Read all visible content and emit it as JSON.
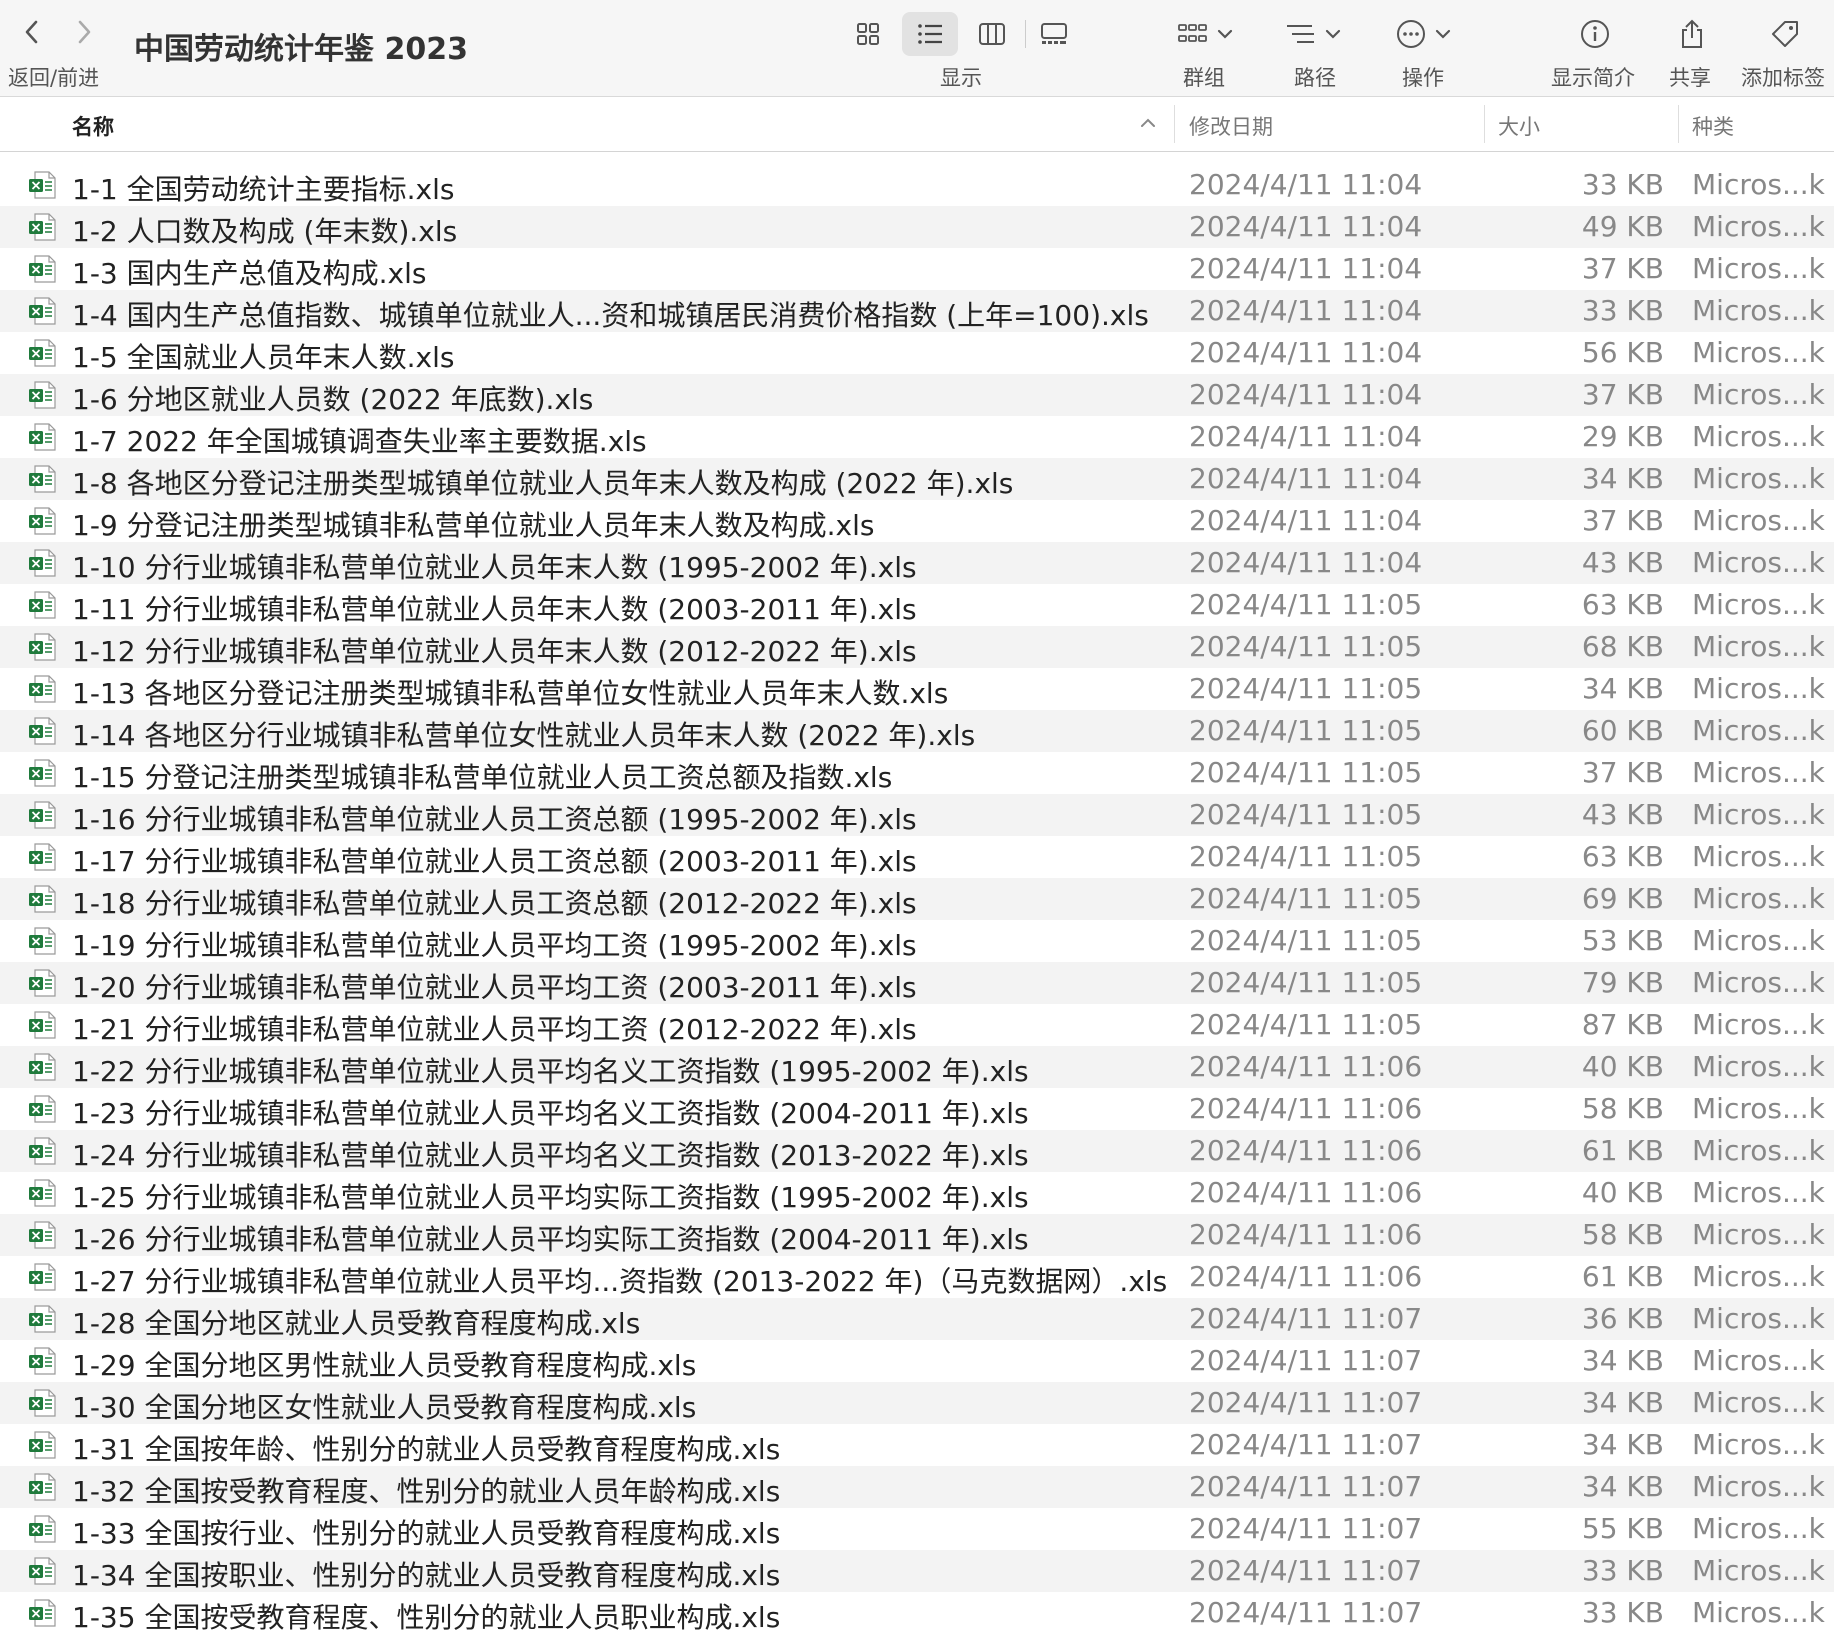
{
  "toolbar": {
    "nav_label": "返回/前进",
    "window_title": "中国劳动统计年鉴 2023",
    "view_label": "显示",
    "group_label": "群组",
    "path_label": "路径",
    "action_label": "操作",
    "info_label": "显示简介",
    "share_label": "共享",
    "tag_label": "添加标签",
    "active_view": "list"
  },
  "columns": {
    "name": "名称",
    "date": "修改日期",
    "size": "大小",
    "kind": "种类"
  },
  "icons": {
    "file": "excel-file-icon",
    "accent_color": "#1f7a3c"
  },
  "files": [
    {
      "name": "1-1 全国劳动统计主要指标.xls",
      "date": "2024/4/11 11:04",
      "size": "33 KB",
      "kind": "Micros...k ("
    },
    {
      "name": "1-2 人口数及构成 (年末数).xls",
      "date": "2024/4/11 11:04",
      "size": "49 KB",
      "kind": "Micros...k ("
    },
    {
      "name": "1-3 国内生产总值及构成.xls",
      "date": "2024/4/11 11:04",
      "size": "37 KB",
      "kind": "Micros...k ("
    },
    {
      "name": "1-4 国内生产总值指数、城镇单位就业人...资和城镇居民消费价格指数 (上年=100).xls",
      "date": "2024/4/11 11:04",
      "size": "33 KB",
      "kind": "Micros...k ("
    },
    {
      "name": "1-5 全国就业人员年末人数.xls",
      "date": "2024/4/11 11:04",
      "size": "56 KB",
      "kind": "Micros...k ("
    },
    {
      "name": "1-6 分地区就业人员数 (2022 年底数).xls",
      "date": "2024/4/11 11:04",
      "size": "37 KB",
      "kind": "Micros...k ("
    },
    {
      "name": "1-7 2022 年全国城镇调查失业率主要数据.xls",
      "date": "2024/4/11 11:04",
      "size": "29 KB",
      "kind": "Micros...k ("
    },
    {
      "name": "1-8 各地区分登记注册类型城镇单位就业人员年末人数及构成 (2022 年).xls",
      "date": "2024/4/11 11:04",
      "size": "34 KB",
      "kind": "Micros...k ("
    },
    {
      "name": "1-9 分登记注册类型城镇非私营单位就业人员年末人数及构成.xls",
      "date": "2024/4/11 11:04",
      "size": "37 KB",
      "kind": "Micros...k ("
    },
    {
      "name": "1-10 分行业城镇非私营单位就业人员年末人数 (1995-2002 年).xls",
      "date": "2024/4/11 11:04",
      "size": "43 KB",
      "kind": "Micros...k ("
    },
    {
      "name": "1-11 分行业城镇非私营单位就业人员年末人数 (2003-2011 年).xls",
      "date": "2024/4/11 11:05",
      "size": "63 KB",
      "kind": "Micros...k ("
    },
    {
      "name": "1-12 分行业城镇非私营单位就业人员年末人数 (2012-2022 年).xls",
      "date": "2024/4/11 11:05",
      "size": "68 KB",
      "kind": "Micros...k ("
    },
    {
      "name": "1-13 各地区分登记注册类型城镇非私营单位女性就业人员年末人数.xls",
      "date": "2024/4/11 11:05",
      "size": "34 KB",
      "kind": "Micros...k ("
    },
    {
      "name": "1-14 各地区分行业城镇非私营单位女性就业人员年末人数 (2022 年).xls",
      "date": "2024/4/11 11:05",
      "size": "60 KB",
      "kind": "Micros...k ("
    },
    {
      "name": "1-15 分登记注册类型城镇非私营单位就业人员工资总额及指数.xls",
      "date": "2024/4/11 11:05",
      "size": "37 KB",
      "kind": "Micros...k ("
    },
    {
      "name": "1-16 分行业城镇非私营单位就业人员工资总额 (1995-2002 年).xls",
      "date": "2024/4/11 11:05",
      "size": "43 KB",
      "kind": "Micros...k ("
    },
    {
      "name": "1-17 分行业城镇非私营单位就业人员工资总额 (2003-2011 年).xls",
      "date": "2024/4/11 11:05",
      "size": "63 KB",
      "kind": "Micros...k ("
    },
    {
      "name": "1-18 分行业城镇非私营单位就业人员工资总额 (2012-2022 年).xls",
      "date": "2024/4/11 11:05",
      "size": "69 KB",
      "kind": "Micros...k ("
    },
    {
      "name": "1-19 分行业城镇非私营单位就业人员平均工资 (1995-2002 年).xls",
      "date": "2024/4/11 11:05",
      "size": "53 KB",
      "kind": "Micros...k ("
    },
    {
      "name": "1-20 分行业城镇非私营单位就业人员平均工资 (2003-2011 年).xls",
      "date": "2024/4/11 11:05",
      "size": "79 KB",
      "kind": "Micros...k ("
    },
    {
      "name": "1-21 分行业城镇非私营单位就业人员平均工资 (2012-2022 年).xls",
      "date": "2024/4/11 11:05",
      "size": "87 KB",
      "kind": "Micros...k ("
    },
    {
      "name": "1-22 分行业城镇非私营单位就业人员平均名义工资指数 (1995-2002 年).xls",
      "date": "2024/4/11 11:06",
      "size": "40 KB",
      "kind": "Micros...k ("
    },
    {
      "name": "1-23 分行业城镇非私营单位就业人员平均名义工资指数 (2004-2011 年).xls",
      "date": "2024/4/11 11:06",
      "size": "58 KB",
      "kind": "Micros...k ("
    },
    {
      "name": "1-24 分行业城镇非私营单位就业人员平均名义工资指数 (2013-2022 年).xls",
      "date": "2024/4/11 11:06",
      "size": "61 KB",
      "kind": "Micros...k ("
    },
    {
      "name": "1-25 分行业城镇非私营单位就业人员平均实际工资指数 (1995-2002 年).xls",
      "date": "2024/4/11 11:06",
      "size": "40 KB",
      "kind": "Micros...k ("
    },
    {
      "name": "1-26 分行业城镇非私营单位就业人员平均实际工资指数 (2004-2011 年).xls",
      "date": "2024/4/11 11:06",
      "size": "58 KB",
      "kind": "Micros...k ("
    },
    {
      "name": "1-27 分行业城镇非私营单位就业人员平均...资指数 (2013-2022 年)（马克数据网）.xls",
      "date": "2024/4/11 11:06",
      "size": "61 KB",
      "kind": "Micros...k ("
    },
    {
      "name": "1-28 全国分地区就业人员受教育程度构成.xls",
      "date": "2024/4/11 11:07",
      "size": "36 KB",
      "kind": "Micros...k ("
    },
    {
      "name": "1-29 全国分地区男性就业人员受教育程度构成.xls",
      "date": "2024/4/11 11:07",
      "size": "34 KB",
      "kind": "Micros...k ("
    },
    {
      "name": "1-30 全国分地区女性就业人员受教育程度构成.xls",
      "date": "2024/4/11 11:07",
      "size": "34 KB",
      "kind": "Micros...k ("
    },
    {
      "name": "1-31 全国按年龄、性别分的就业人员受教育程度构成.xls",
      "date": "2024/4/11 11:07",
      "size": "34 KB",
      "kind": "Micros...k ("
    },
    {
      "name": "1-32 全国按受教育程度、性别分的就业人员年龄构成.xls",
      "date": "2024/4/11 11:07",
      "size": "34 KB",
      "kind": "Micros...k ("
    },
    {
      "name": "1-33 全国按行业、性别分的就业人员受教育程度构成.xls",
      "date": "2024/4/11 11:07",
      "size": "55 KB",
      "kind": "Micros...k ("
    },
    {
      "name": "1-34 全国按职业、性别分的就业人员受教育程度构成.xls",
      "date": "2024/4/11 11:07",
      "size": "33 KB",
      "kind": "Micros...k ("
    },
    {
      "name": "1-35 全国按受教育程度、性别分的就业人员职业构成.xls",
      "date": "2024/4/11 11:07",
      "size": "33 KB",
      "kind": "Micros...k ("
    }
  ]
}
